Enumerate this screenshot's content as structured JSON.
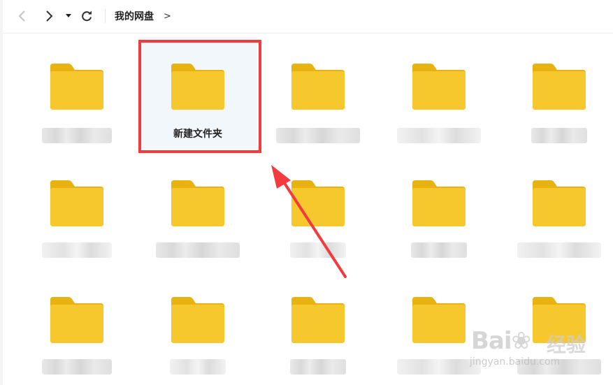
{
  "toolbar": {
    "breadcrumb": [
      {
        "label": "我的网盘"
      }
    ],
    "breadcrumb_separator": ">"
  },
  "folders": [
    {
      "label": "",
      "selected": false
    },
    {
      "label": "新建文件夹",
      "selected": true
    },
    {
      "label": "",
      "selected": false
    },
    {
      "label": "",
      "selected": false
    },
    {
      "label": "",
      "selected": false
    },
    {
      "label": "",
      "selected": false
    },
    {
      "label": "",
      "selected": false
    },
    {
      "label": "",
      "selected": false
    },
    {
      "label": "",
      "selected": false
    },
    {
      "label": "",
      "selected": false
    },
    {
      "label": "",
      "selected": false
    },
    {
      "label": "",
      "selected": false
    },
    {
      "label": "",
      "selected": false
    },
    {
      "label": "",
      "selected": false
    },
    {
      "label": "",
      "selected": false
    }
  ],
  "colors": {
    "folder": "#f7c82d",
    "folder_tab": "#e8b311",
    "highlight": "#f33a3f",
    "selection_bg": "#f2f7fc"
  },
  "watermark": {
    "logo": "Bai❀",
    "cn": "经验",
    "url": "jingyan.baidu.com"
  }
}
